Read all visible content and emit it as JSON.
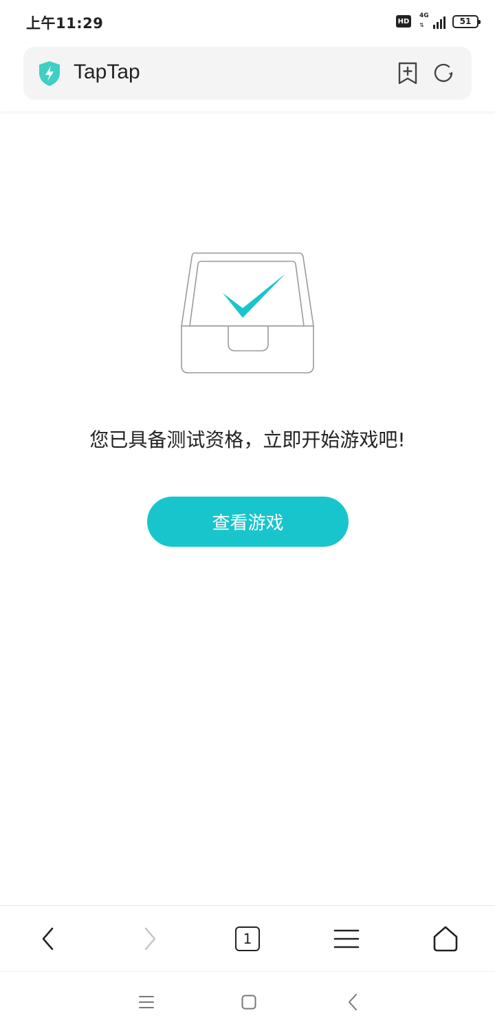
{
  "status_bar": {
    "time": "上午11:29",
    "hd_label": "HD",
    "network_label": "4G",
    "battery_level": "51"
  },
  "address_bar": {
    "site_name": "TapTap",
    "site_icon": "shield-lightning-icon",
    "accent_color": "#3fcfc4"
  },
  "main": {
    "illustration_icon": "drawer-checkmark-icon",
    "message": "您已具备测试资格，立即开始游戏吧!",
    "view_game_label": "查看游戏",
    "button_color": "#19c5cd"
  },
  "toolbar": {
    "back_icon": "chevron-left-icon",
    "forward_icon": "chevron-right-icon",
    "tab_count": "1",
    "menu_icon": "menu-icon",
    "home_icon": "home-icon"
  },
  "system_nav": {
    "recents_icon": "recents-icon",
    "home_icon": "home-square-icon",
    "back_icon": "back-icon"
  }
}
